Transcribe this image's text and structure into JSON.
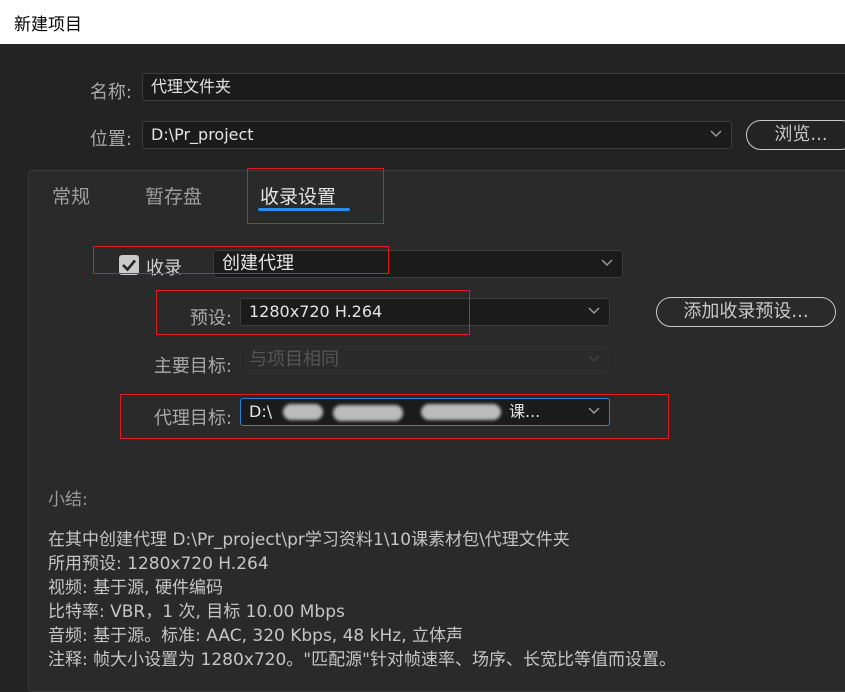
{
  "window": {
    "title": "新建项目"
  },
  "name_row": {
    "label": "名称:",
    "value": "代理文件夹"
  },
  "location_row": {
    "label": "位置:",
    "value": "D:\\Pr_project",
    "browse_label": "浏览..."
  },
  "tabs": [
    {
      "label": "常规"
    },
    {
      "label": "暂存盘"
    },
    {
      "label": "收录设置"
    }
  ],
  "ingest": {
    "checkbox_label": "收录",
    "checked": true,
    "mode_value": "创建代理",
    "preset_label": "预设:",
    "preset_value": "1280x720 H.264",
    "add_preset_label": "添加收录预设...",
    "primary_target_label": "主要目标:",
    "primary_target_value": "与项目相同",
    "proxy_target_label": "代理目标:",
    "proxy_target_value_start": "D:\\",
    "proxy_target_value_end": "课..."
  },
  "summary": {
    "title": "小结:",
    "lines": [
      "在其中创建代理 D:\\Pr_project\\pr学习资料1\\10课素材包\\代理文件夹",
      "所用预设: 1280x720 H.264",
      "视频: 基于源, 硬件编码",
      "比特率: VBR，1 次, 目标 10.00 Mbps",
      "音频: 基于源。标准: AAC, 320 Kbps, 48  kHz, 立体声",
      "注释: 帧大小设置为 1280x720。\"匹配源\"针对帧速率、场序、长宽比等值而设置。"
    ]
  },
  "colors": {
    "accent": "#2d8ceb",
    "highlight_box": "#e01b1b",
    "background": "#232323"
  }
}
